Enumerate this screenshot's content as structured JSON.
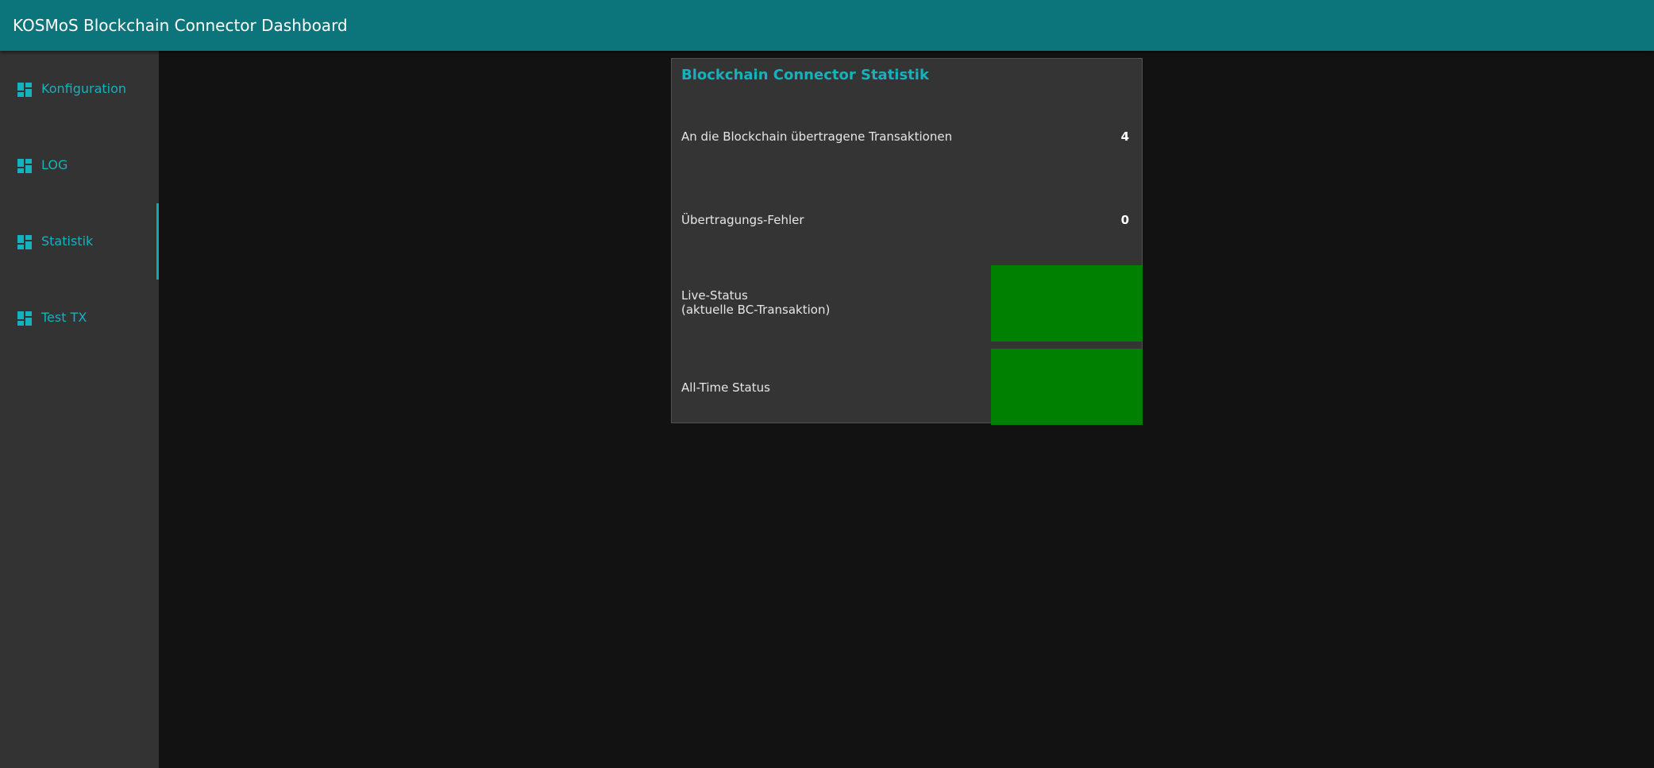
{
  "header": {
    "title": "KOSMoS Blockchain Connector Dashboard"
  },
  "sidebar": {
    "icon": "dashboard-icon",
    "active_index": 2,
    "items": [
      {
        "label": "Konfiguration"
      },
      {
        "label": "LOG"
      },
      {
        "label": "Statistik"
      },
      {
        "label": "Test TX"
      }
    ]
  },
  "stats_card": {
    "title": "Blockchain Connector Statistik",
    "transmitted_label": "An die Blockchain übertragene Transaktionen",
    "transmitted_value": "4",
    "errors_label": "Übertragungs-Fehler",
    "errors_value": "0",
    "live_status_label_line1": "Live-Status",
    "live_status_label_line2": "(aktuelle BC-Transaktion)",
    "live_status_color": "#008000",
    "alltime_status_label": "All-Time Status",
    "alltime_status_color": "#008000"
  },
  "colors": {
    "header_bg": "#0b757b",
    "sidebar_bg": "#333333",
    "accent": "#17b1bd",
    "page_bg": "#121212",
    "card_bg": "#343434"
  }
}
